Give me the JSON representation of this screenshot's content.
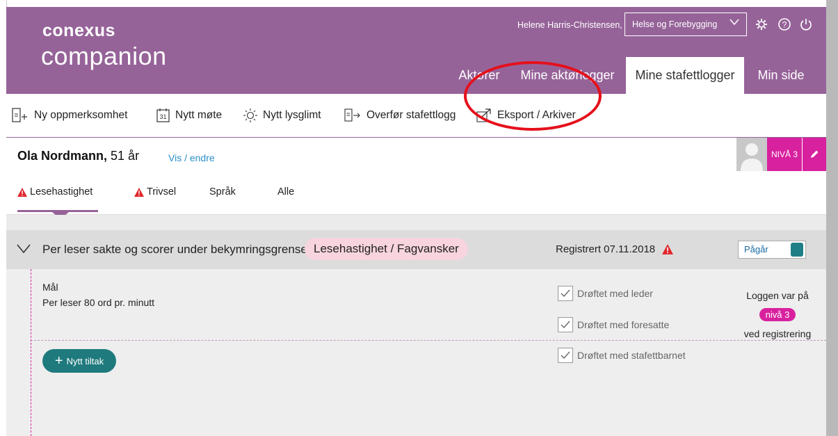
{
  "header": {
    "logo_top": "conexus",
    "logo_bottom": "companion",
    "user_name": "Helene Harris-Christensen,",
    "department": "Helse og Forebygging",
    "tabs": [
      {
        "label": "Aktører"
      },
      {
        "label": "Mine aktørlogger"
      },
      {
        "label": "Mine stafettlogger",
        "active": true
      },
      {
        "label": "Min side"
      }
    ],
    "icons": [
      "settings-gear-icon",
      "help-icon",
      "power-icon"
    ]
  },
  "toolbar": {
    "items": [
      {
        "label": "Ny oppmerksomhet",
        "icon": "document-add-icon"
      },
      {
        "label": "Nytt møte",
        "icon": "calendar-31-icon"
      },
      {
        "label": "Nytt lysglimt",
        "icon": "sun-icon"
      },
      {
        "label": "Overfør stafettlogg",
        "icon": "document-transfer-icon"
      },
      {
        "label": "Eksport / Arkiver",
        "icon": "export-icon"
      }
    ]
  },
  "person": {
    "name": "Ola Nordmann,",
    "age": "51 år",
    "edit_link": "Vis / endre",
    "level_badge": "NIVÅ 3",
    "tabs": [
      {
        "label": "Lesehastighet",
        "warning": true,
        "active": true
      },
      {
        "label": "Trivsel",
        "warning": true
      },
      {
        "label": "Språk"
      },
      {
        "label": "Alle"
      }
    ]
  },
  "log": {
    "title": "Per leser sakte og scorer under bekymringsgrense",
    "tag": "Lesehastighet / Fagvansker",
    "registered": "Registrert 07.11.2018",
    "status": "Pågår",
    "goal_label": "Mål",
    "goal_text": "Per leser 80 ord pr. minutt",
    "checks": [
      {
        "label": "Drøftet med leder",
        "checked": true
      },
      {
        "label": "Drøftet med foresatte",
        "checked": true
      },
      {
        "label": "Drøftet med stafettbarnet",
        "checked": true
      }
    ],
    "level_info_pre": "Loggen var på",
    "level_info_pill": "nivå 3",
    "level_info_post": "ved registrering",
    "new_action_button": "Nytt tiltak"
  },
  "colors": {
    "brand_purple": "#966399",
    "accent_magenta": "#d8219e",
    "teal": "#1f7a7e",
    "warning_red": "#e0282c",
    "annotation_red": "#e5101b"
  }
}
